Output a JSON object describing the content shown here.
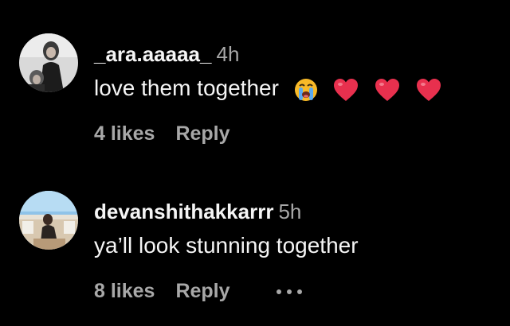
{
  "comments": [
    {
      "username": "_ara.aaaaa_",
      "time": "4h",
      "text": "love them together",
      "emojis": [
        "crying-face-icon",
        "red-heart-icon",
        "red-heart-icon",
        "red-heart-icon"
      ],
      "likes": "4 likes",
      "reply": "Reply"
    },
    {
      "username": "devanshithakkarrr",
      "time": "5h",
      "text": "ya’ll look stunning together",
      "emojis": [],
      "likes": "8 likes",
      "reply": "Reply",
      "more": "more-options-icon"
    }
  ],
  "colors": {
    "background": "#000000",
    "primary_text": "#f5f5f5",
    "secondary_text": "#a8a8a8",
    "heart": "#e8304e",
    "crying_face": "#f7b928",
    "tears": "#5aa9f0"
  }
}
